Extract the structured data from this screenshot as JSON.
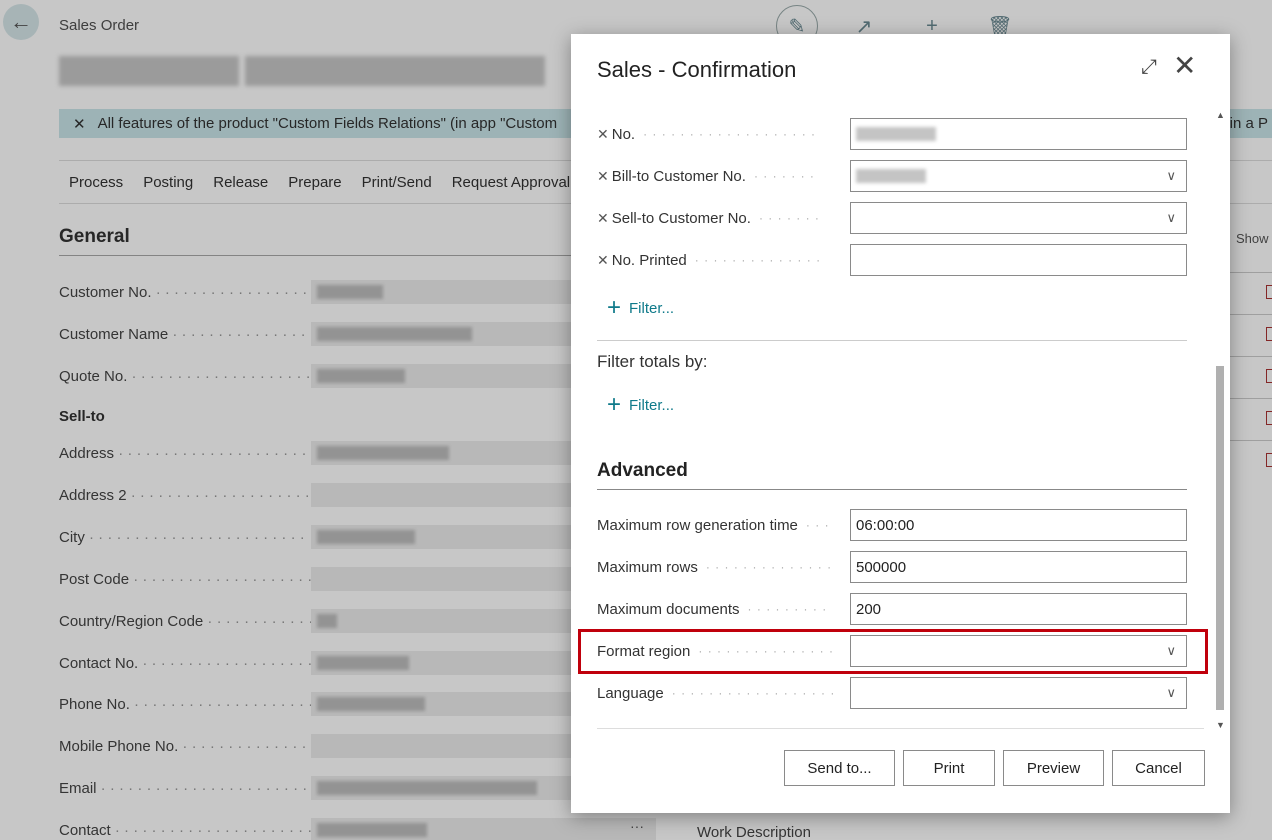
{
  "background": {
    "caption": "Sales Order",
    "banner_text": "All features of the product \"Custom Fields Relations\" (in app \"Custom",
    "banner_tail": "s in a P",
    "action_bar": [
      "Process",
      "Posting",
      "Release",
      "Prepare",
      "Print/Send",
      "Request Approval"
    ],
    "section_title": "General",
    "show_label": "Show",
    "fields": [
      {
        "label": "Customer No."
      },
      {
        "label": "Customer Name"
      },
      {
        "label": "Quote No."
      },
      {
        "label": "Address"
      },
      {
        "label": "Address 2"
      },
      {
        "label": "City"
      },
      {
        "label": "Post Code"
      },
      {
        "label": "Country/Region Code"
      },
      {
        "label": "Contact No."
      },
      {
        "label": "Phone No."
      },
      {
        "label": "Mobile Phone No."
      },
      {
        "label": "Email"
      },
      {
        "label": "Contact"
      }
    ],
    "sellto_label": "Sell-to",
    "work_description": "Work Description",
    "contact_more": "···"
  },
  "dialog": {
    "title": "Sales - Confirmation",
    "filters": [
      {
        "label": "No.",
        "value": "",
        "dropdown": false
      },
      {
        "label": "Bill-to Customer No.",
        "value": "",
        "dropdown": true
      },
      {
        "label": "Sell-to Customer No.",
        "value": "",
        "dropdown": true
      },
      {
        "label": "No. Printed",
        "value": "",
        "dropdown": false
      }
    ],
    "filter_link": "Filter...",
    "filter_totals_label": "Filter totals by:",
    "filter_totals_link": "Filter...",
    "advanced_title": "Advanced",
    "advanced": {
      "max_row_time_label": "Maximum row generation time",
      "max_row_time_value": "06:00:00",
      "max_rows_label": "Maximum rows",
      "max_rows_value": "500000",
      "max_docs_label": "Maximum documents",
      "max_docs_value": "200",
      "format_region_label": "Format region",
      "format_region_value": "",
      "language_label": "Language",
      "language_value": ""
    },
    "buttons": {
      "send_to": "Send to...",
      "print": "Print",
      "preview": "Preview",
      "cancel": "Cancel"
    }
  },
  "colors": {
    "accent": "#0f7a8a",
    "highlight": "#c0000c",
    "banner": "#c9e6ea"
  }
}
